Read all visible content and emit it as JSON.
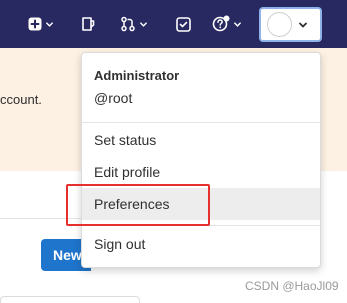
{
  "navbar": {
    "icons": [
      "plus-square-icon",
      "chevron-down-icon",
      "todo-notes-icon",
      "merge-request-icon",
      "chevron-down-icon",
      "check-square-icon",
      "help-question-icon",
      "chevron-down-icon"
    ],
    "background_color": "#292961",
    "user_chevron_icon": "chevron-down-icon"
  },
  "background": {
    "alert_text": "ccount.",
    "new_button_label": "New",
    "alert_color": "#fdf1e3",
    "button_color": "#1f75cb"
  },
  "user_menu": {
    "name": "Administrator",
    "username": "@root",
    "items": [
      {
        "label": "Set status"
      },
      {
        "label": "Edit profile"
      },
      {
        "label": "Preferences"
      },
      {
        "label": "Sign out"
      }
    ],
    "active_item": "Preferences",
    "highlight_color": "#e5302e"
  },
  "watermark": "CSDN @HaoJl09"
}
